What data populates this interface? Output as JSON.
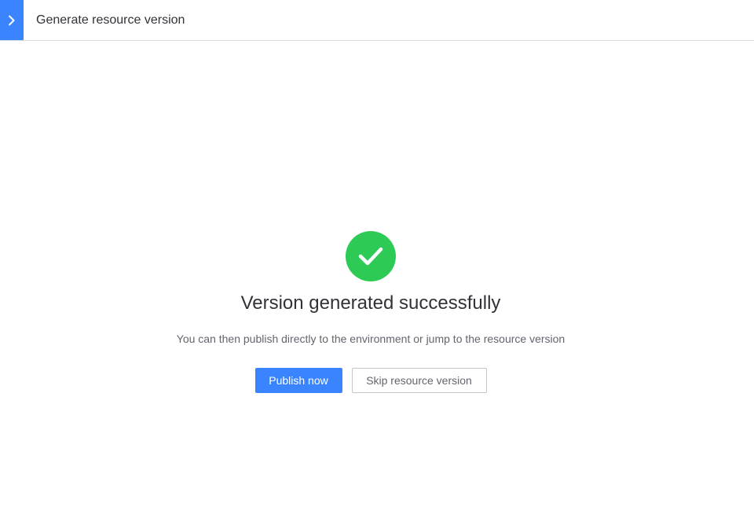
{
  "header": {
    "toggle_icon": "chevron-right-icon",
    "title": "Generate resource version"
  },
  "result": {
    "status_icon": "check-circle-icon",
    "title": "Version generated successfully",
    "description": "You can then publish directly to the environment or jump to the resource version"
  },
  "actions": {
    "primary_label": "Publish now",
    "secondary_label": "Skip resource version"
  },
  "colors": {
    "accent": "#3a84ff",
    "success": "#2dcb56"
  }
}
